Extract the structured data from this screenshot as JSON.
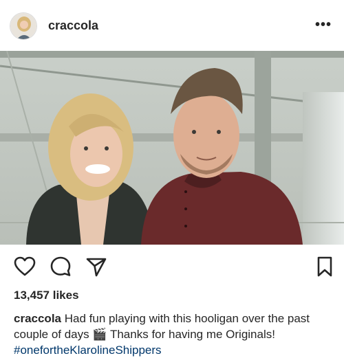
{
  "post": {
    "username": "craccola",
    "more_label": "•••",
    "likes": "13,457 likes",
    "caption_user": "craccola",
    "caption_text_1": "Had fun playing with this hooligan over the past couple of days",
    "caption_emoji": "🎬",
    "caption_text_2": "Thanks for having me Originals!",
    "caption_hashtag": "#onefortheKlarolineShippers"
  },
  "icons": {
    "like": "heart-icon",
    "comment": "comment-icon",
    "share": "send-icon",
    "save": "bookmark-icon",
    "more": "more-options-icon"
  },
  "colors": {
    "text": "#262626",
    "hashtag": "#00376b",
    "border": "#dbdbdb"
  }
}
